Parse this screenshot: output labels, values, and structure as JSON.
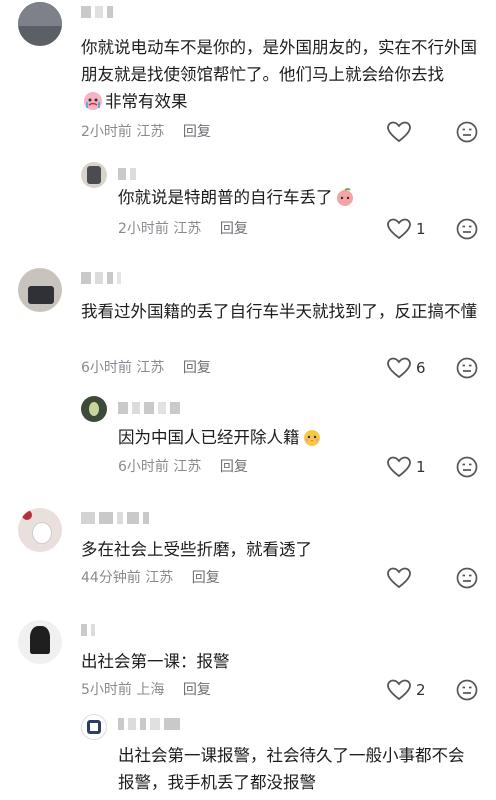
{
  "comments": [
    {
      "text": "你就说电动车不是你的，是外国朋友的，实在不行外国朋友就是找使领馆帮忙了。他们马上就会给你去找",
      "text2": "非常有效果",
      "time": "2小时前",
      "location": "江苏",
      "reply": "回复",
      "likes": ""
    },
    {
      "text": "你就说是特朗普的自行车丢了",
      "time": "2小时前",
      "location": "江苏",
      "reply": "回复",
      "likes": "1"
    },
    {
      "text": "我看过外国籍的丢了自行车半天就找到了，反正搞不懂",
      "time": "6小时前",
      "location": "江苏",
      "reply": "回复",
      "likes": "6"
    },
    {
      "text": "因为中国人已经开除人籍",
      "time": "6小时前",
      "location": "江苏",
      "reply": "回复",
      "likes": "1"
    },
    {
      "text": "多在社会上受些折磨，就看透了",
      "time": "44分钟前",
      "location": "江苏",
      "reply": "回复",
      "likes": ""
    },
    {
      "text": "出社会第一课：报警",
      "time": "5小时前",
      "location": "上海",
      "reply": "回复",
      "likes": "2"
    },
    {
      "text": "出社会第一课报警，社会待久了一般小事都不会报警，我手机丢了都没报警",
      "time": "",
      "location": "",
      "reply": "",
      "likes": ""
    }
  ]
}
